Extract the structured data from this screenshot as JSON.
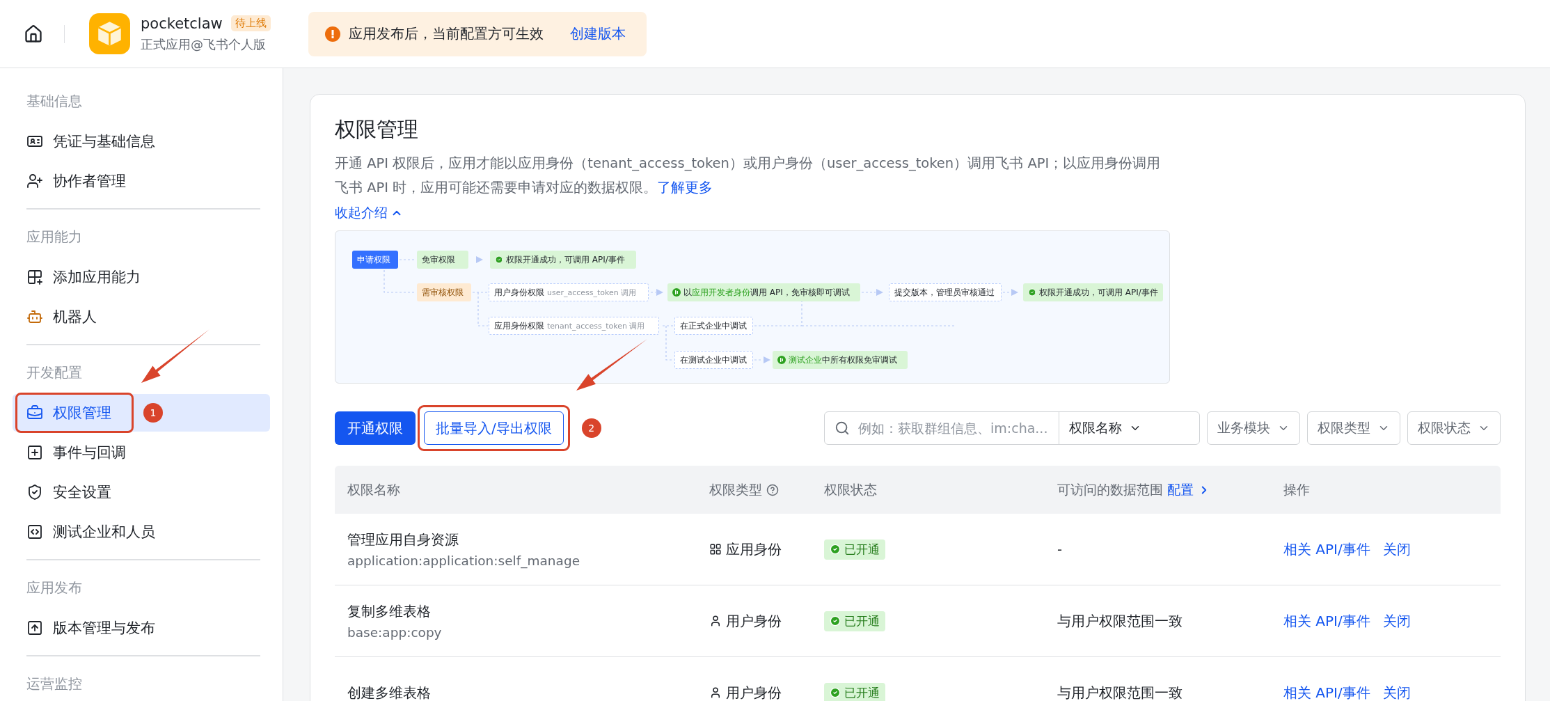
{
  "header": {
    "app_name": "pocketclaw",
    "app_tag": "待上线",
    "app_subtitle": "正式应用@飞书个人版",
    "notice": {
      "text": "应用发布后，当前配置方可生效",
      "link": "创建版本"
    }
  },
  "sidebar": {
    "sections": [
      {
        "title": "基础信息",
        "items": [
          {
            "label": "凭证与基础信息",
            "selected": false,
            "highlighted": false
          },
          {
            "label": "协作者管理",
            "selected": false,
            "highlighted": false
          }
        ]
      },
      {
        "title": "应用能力",
        "items": [
          {
            "label": "添加应用能力",
            "selected": false,
            "highlighted": false
          },
          {
            "label": "机器人",
            "selected": false,
            "highlighted": false
          }
        ]
      },
      {
        "title": "开发配置",
        "items": [
          {
            "label": "权限管理",
            "selected": true,
            "highlighted": true,
            "annotation": "1"
          },
          {
            "label": "事件与回调",
            "selected": false,
            "highlighted": false
          },
          {
            "label": "安全设置",
            "selected": false,
            "highlighted": false
          },
          {
            "label": "测试企业和人员",
            "selected": false,
            "highlighted": false
          }
        ]
      },
      {
        "title": "应用发布",
        "items": [
          {
            "label": "版本管理与发布",
            "selected": false,
            "highlighted": false
          }
        ]
      },
      {
        "title": "运营监控"
      }
    ]
  },
  "page": {
    "title": "权限管理",
    "description": "开通 API 权限后，应用才能以应用身份（tenant_access_token）或用户身份（user_access_token）调用飞书 API；以应用身份调用飞书 API 时，应用可能还需要申请对应的数据权限。",
    "learn_more": "了解更多",
    "collapse": "收起介绍",
    "diagram": [
      {
        "kind": "start",
        "segments": [
          {
            "text": "申请权限",
            "accent": false
          }
        ]
      },
      {
        "kind": "free",
        "segments": [
          {
            "text": "免审权限",
            "accent": false
          }
        ]
      },
      {
        "kind": "success",
        "segments": [
          {
            "text": "权限开通成功，可调用 API/事件",
            "accent": false
          }
        ]
      },
      {
        "kind": "review",
        "segments": [
          {
            "text": "需审核权限",
            "accent": false
          }
        ]
      },
      {
        "kind": "plain",
        "segments": [
          {
            "text": "用户身份权限",
            "accent": false
          }
        ],
        "note": "user_access_token 调用"
      },
      {
        "kind": "dev",
        "segments": [
          {
            "text": "以",
            "accent": false
          },
          {
            "text": "应用开发者身份",
            "accent": true
          },
          {
            "text": "调用 API，免审核即可调试",
            "accent": false
          }
        ]
      },
      {
        "kind": "plain",
        "segments": [
          {
            "text": "提交版本，管理员审核通过",
            "accent": false
          }
        ]
      },
      {
        "kind": "success",
        "segments": [
          {
            "text": "权限开通成功，可调用 API/事件",
            "accent": false
          }
        ]
      },
      {
        "kind": "plain",
        "segments": [
          {
            "text": "应用身份权限",
            "accent": false
          }
        ],
        "note": "tenant_access_token 调用"
      },
      {
        "kind": "plain",
        "segments": [
          {
            "text": "在正式企业中调试",
            "accent": false
          }
        ]
      },
      {
        "kind": "plain",
        "segments": [
          {
            "text": "在测试企业中调试",
            "accent": false
          }
        ]
      },
      {
        "kind": "dev",
        "segments": [
          {
            "text": "测试企业",
            "accent": true
          },
          {
            "text": "中所有权限免审调试",
            "accent": false
          }
        ]
      }
    ],
    "toolbar": {
      "primary_button": "开通权限",
      "secondary_button": {
        "label": "批量导入/导出权限",
        "highlighted": true,
        "annotation": "2"
      },
      "search_placeholder": "例如：获取群组信息、im:cha...",
      "search_scope": "权限名称",
      "filters": [
        "业务模块",
        "权限类型",
        "权限状态"
      ]
    },
    "table": {
      "columns": [
        {
          "label": "权限名称"
        },
        {
          "label": "权限类型",
          "help": true
        },
        {
          "label": "权限状态"
        },
        {
          "label": "可访问的数据范围",
          "link": "配置"
        },
        {
          "label": "操作"
        }
      ],
      "rows": [
        {
          "name": "管理应用自身资源",
          "scope": "application:application:self_manage",
          "type": {
            "kind": "app",
            "label": "应用身份"
          },
          "status": {
            "kind": "enabled",
            "label": "已开通"
          },
          "data_range": "-",
          "actions": [
            "相关 API/事件",
            "关闭"
          ]
        },
        {
          "name": "复制多维表格",
          "scope": "base:app:copy",
          "type": {
            "kind": "user",
            "label": "用户身份"
          },
          "status": {
            "kind": "enabled",
            "label": "已开通"
          },
          "data_range": "与用户权限范围一致",
          "actions": [
            "相关 API/事件",
            "关闭"
          ]
        },
        {
          "name": "创建多维表格",
          "type": {
            "kind": "user",
            "label": "用户身份"
          },
          "status": {
            "kind": "enabled",
            "label": "已开通"
          },
          "data_range": "与用户权限范围一致",
          "actions": [
            "相关 API/事件",
            "关闭"
          ]
        }
      ]
    }
  }
}
